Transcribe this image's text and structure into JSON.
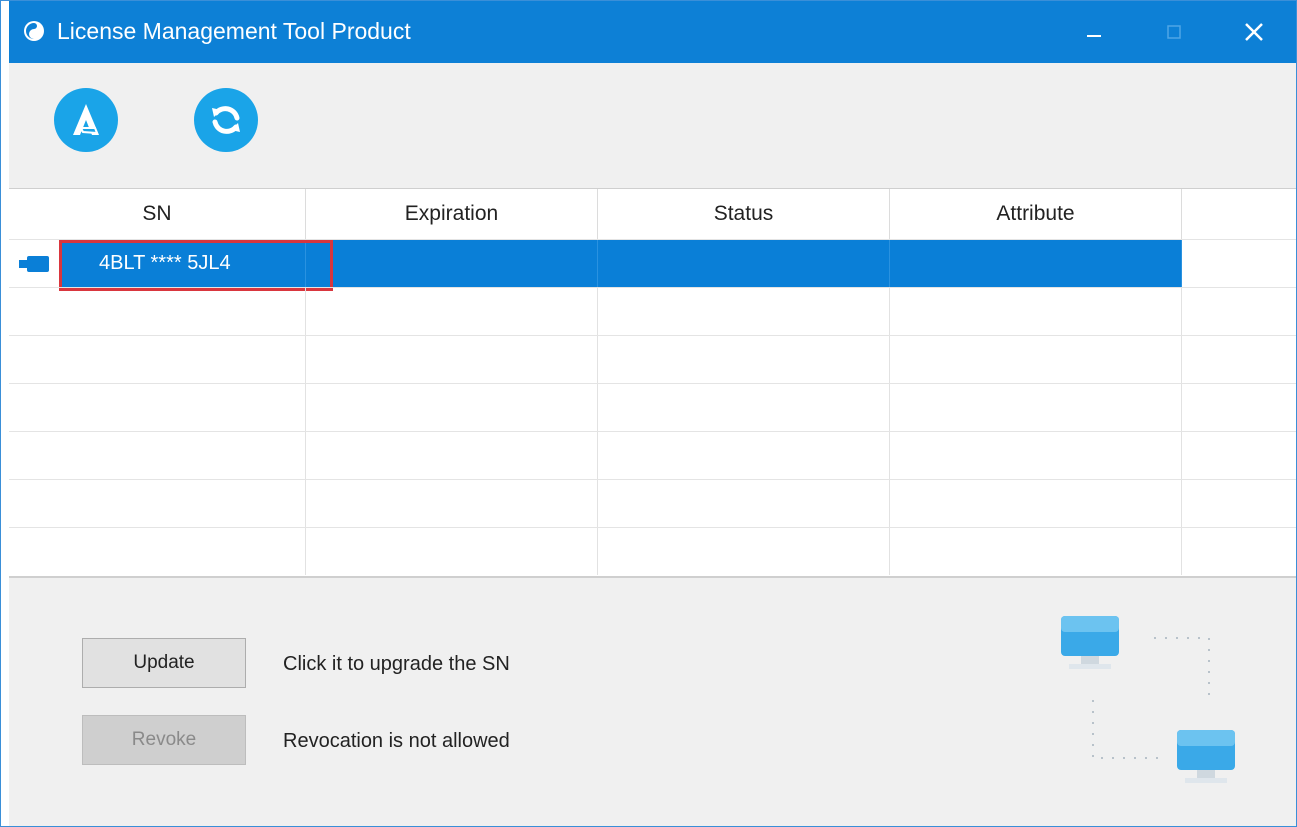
{
  "window": {
    "title": "License Management Tool Product",
    "colors": {
      "titlebar": "#0d80d6",
      "accent": "#1aa4e8",
      "selection": "#0a7fd7",
      "highlight_border": "#d9363e"
    }
  },
  "titlebar": {
    "icons": [
      "app-logo-icon",
      "minimize-icon",
      "maximize-icon",
      "close-icon"
    ]
  },
  "toolbar": {
    "buttons": [
      {
        "icon": "activate-a-icon"
      },
      {
        "icon": "refresh-icon"
      }
    ]
  },
  "grid": {
    "columns": [
      "SN",
      "Expiration",
      "Status",
      "Attribute"
    ],
    "rows": [
      {
        "sn": "4BLT **** 5JL4",
        "expiration": "",
        "status": "",
        "attribute": "",
        "selected": true,
        "icon": "usb-key-icon"
      }
    ],
    "empty_rows": 6
  },
  "actions": {
    "update": {
      "label": "Update",
      "description": "Click it to upgrade the SN",
      "enabled": true
    },
    "revoke": {
      "label": "Revoke",
      "description": "Revocation is not allowed",
      "enabled": false
    }
  },
  "illustration": {
    "icon": "network-computers-icon"
  }
}
